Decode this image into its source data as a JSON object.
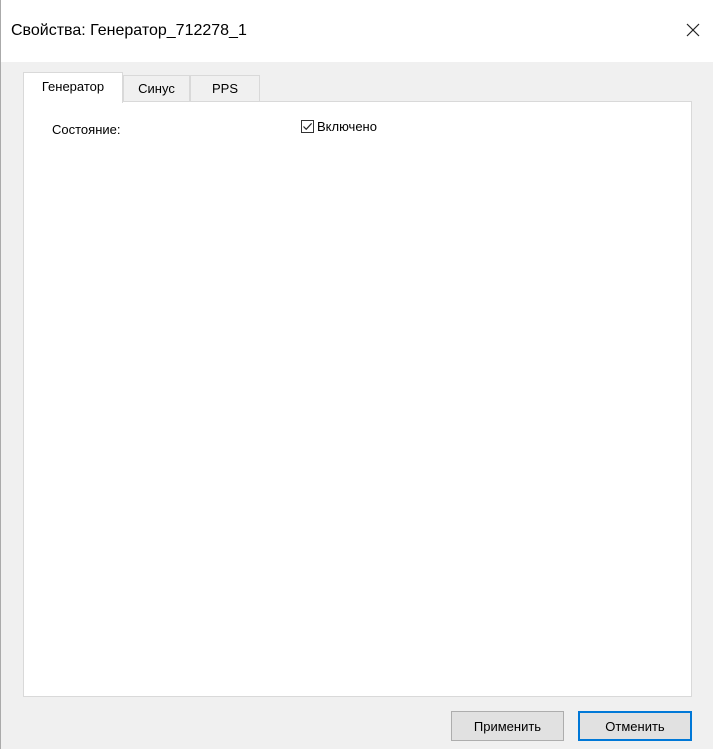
{
  "window": {
    "title": "Свойства: Генератор_712278_1"
  },
  "tabs": [
    {
      "label": "Генератор",
      "active": true
    },
    {
      "label": "Синус",
      "active": false
    },
    {
      "label": "PPS",
      "active": false
    }
  ],
  "generator_tab": {
    "state_label": "Состояние:",
    "enabled_checkbox": {
      "label": "Включено",
      "checked": true
    }
  },
  "buttons": {
    "apply_label": "Применить",
    "cancel_label": "Отменить"
  },
  "icons": {
    "close": "close-icon",
    "checkmark": "checkmark-icon"
  },
  "colors": {
    "accent": "#0078d7",
    "dialog_background": "#f0f0f0",
    "panel_background": "#ffffff"
  }
}
